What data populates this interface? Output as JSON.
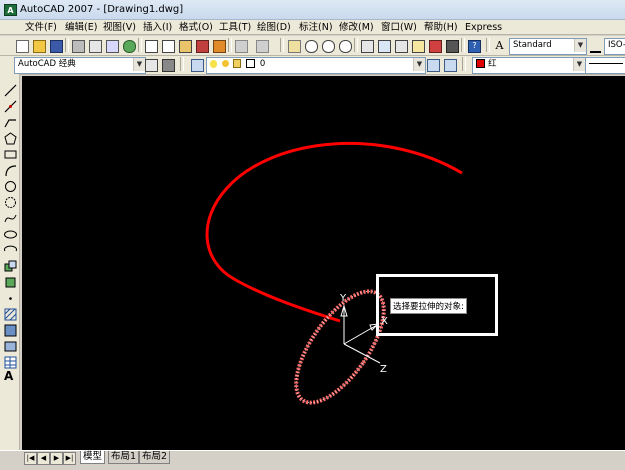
{
  "window": {
    "title": "AutoCAD 2007 - [Drawing1.dwg]",
    "logo_text": "A"
  },
  "menu": [
    "文件(F)",
    "编辑(E)",
    "视图(V)",
    "插入(I)",
    "格式(O)",
    "工具(T)",
    "绘图(D)",
    "标注(N)",
    "修改(M)",
    "窗口(W)",
    "帮助(H)",
    "Express"
  ],
  "toolbar_workspace": {
    "value": "AutoCAD 经典"
  },
  "toolbar_layer": {
    "value": "0"
  },
  "toolbar_style": {
    "text_style": "Standard",
    "dim_style": "ISO-"
  },
  "toolbar_color": {
    "value": "红",
    "swatch": "#e00000"
  },
  "tabs": {
    "model": "模型",
    "layout1": "布局1",
    "layout2": "布局2"
  },
  "prompt": {
    "text": "选择要拉伸的对象:"
  },
  "ucs": {
    "x_label": "X",
    "y_label": "Y",
    "z_label": "Z"
  },
  "colors": {
    "drawing_bg": "#000000",
    "curve": "#ff0000",
    "accent": "#1f6d3b"
  }
}
